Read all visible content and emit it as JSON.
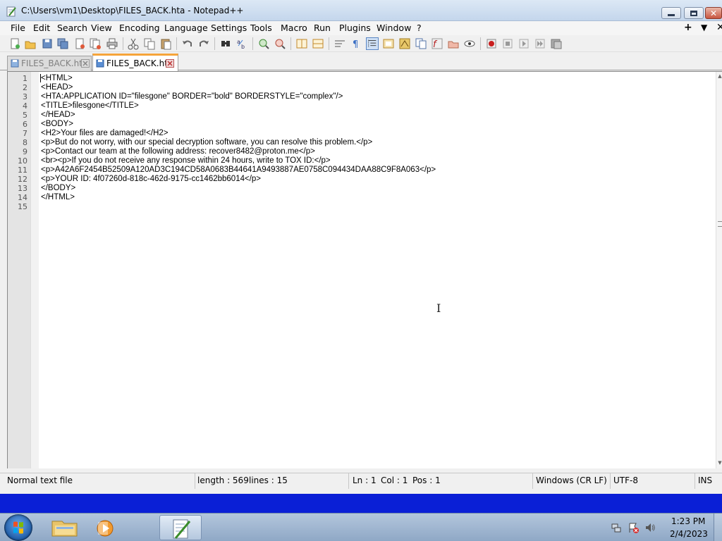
{
  "window": {
    "title": "C:\\Users\\vm1\\Desktop\\FILES_BACK.hta - Notepad++"
  },
  "menu": [
    "File",
    "Edit",
    "Search",
    "View",
    "Encoding",
    "Language",
    "Settings",
    "Tools",
    "Macro",
    "Run",
    "Plugins",
    "Window",
    "?"
  ],
  "menu_right": {
    "plus": "+",
    "down": "▼",
    "close": "✕"
  },
  "toolbar_icons": [
    "new-file-icon",
    "open-file-icon",
    "save-icon",
    "save-all-icon",
    "close-icon",
    "close-all-icon",
    "print-icon",
    "cut-icon",
    "copy-icon",
    "paste-icon",
    "undo-icon",
    "redo-icon",
    "find-icon",
    "replace-icon",
    "zoom-in-icon",
    "zoom-out-icon",
    "sync-vertical-icon",
    "sync-horizontal-icon",
    "word-wrap-icon",
    "show-all-characters-icon",
    "indent-guide-icon",
    "user-defined-language-icon",
    "document-map-icon",
    "function-list-icon",
    "folder-as-workspace-icon",
    "monitoring-icon",
    "record-macro-icon",
    "stop-recording-icon",
    "playback-macro-icon",
    "run-macro-multiple-icon",
    "save-macro-icon"
  ],
  "tabs": [
    {
      "label": "FILES_BACK.hta",
      "active": false
    },
    {
      "label": "FILES_BACK.hta",
      "active": true
    }
  ],
  "editor": {
    "lines": [
      "<HTML>",
      "<HEAD>",
      "<HTA:APPLICATION ID=\"filesgone\" BORDER=\"bold\" BORDERSTYLE=\"complex\"/>",
      "<TITLE>filesgone</TITLE>",
      "</HEAD>",
      "<BODY>",
      "<H2>Your files are damaged!</H2>",
      "<p>But do not worry, with our special decryption software, you can resolve this problem.</p>",
      "<p>Contact our team at the following address: recover8482@proton.me</p>",
      "<br><p>If you do not receive any response within 24 hours, write to TOX ID:</p>",
      "<p>A42A6F2454B52509A120AD3C194CD58A0683B44641A9493887AE0758C094434DAA88C9F8A063</p>",
      "<p>YOUR ID: 4f07260d-818c-462d-9175-cc1462bb6014</p>",
      "</BODY>",
      "</HTML>",
      ""
    ],
    "line_numbers": [
      "1",
      "2",
      "3",
      "4",
      "5",
      "6",
      "7",
      "8",
      "9",
      "10",
      "11",
      "12",
      "13",
      "14",
      "15"
    ]
  },
  "status": {
    "file_type": "Normal text file",
    "length": "length : 569",
    "lines": "lines : 15",
    "ln": "Ln : 1",
    "col": "Col : 1",
    "pos": "Pos : 1",
    "eol": "Windows (CR LF)",
    "encoding": "UTF-8",
    "mode": "INS"
  },
  "taskbar": {
    "apps": [
      "explorer-icon",
      "media-player-icon",
      "notepadplusplus-icon"
    ],
    "tray_icons": [
      "network-icon",
      "action-center-icon",
      "volume-icon"
    ],
    "time": "1:23 PM",
    "date": "2/4/2023"
  },
  "colors": {
    "desktop": "#0a1fd6",
    "active_tab_accent": "#f6a43a",
    "gutter": "#e4e4e4"
  }
}
